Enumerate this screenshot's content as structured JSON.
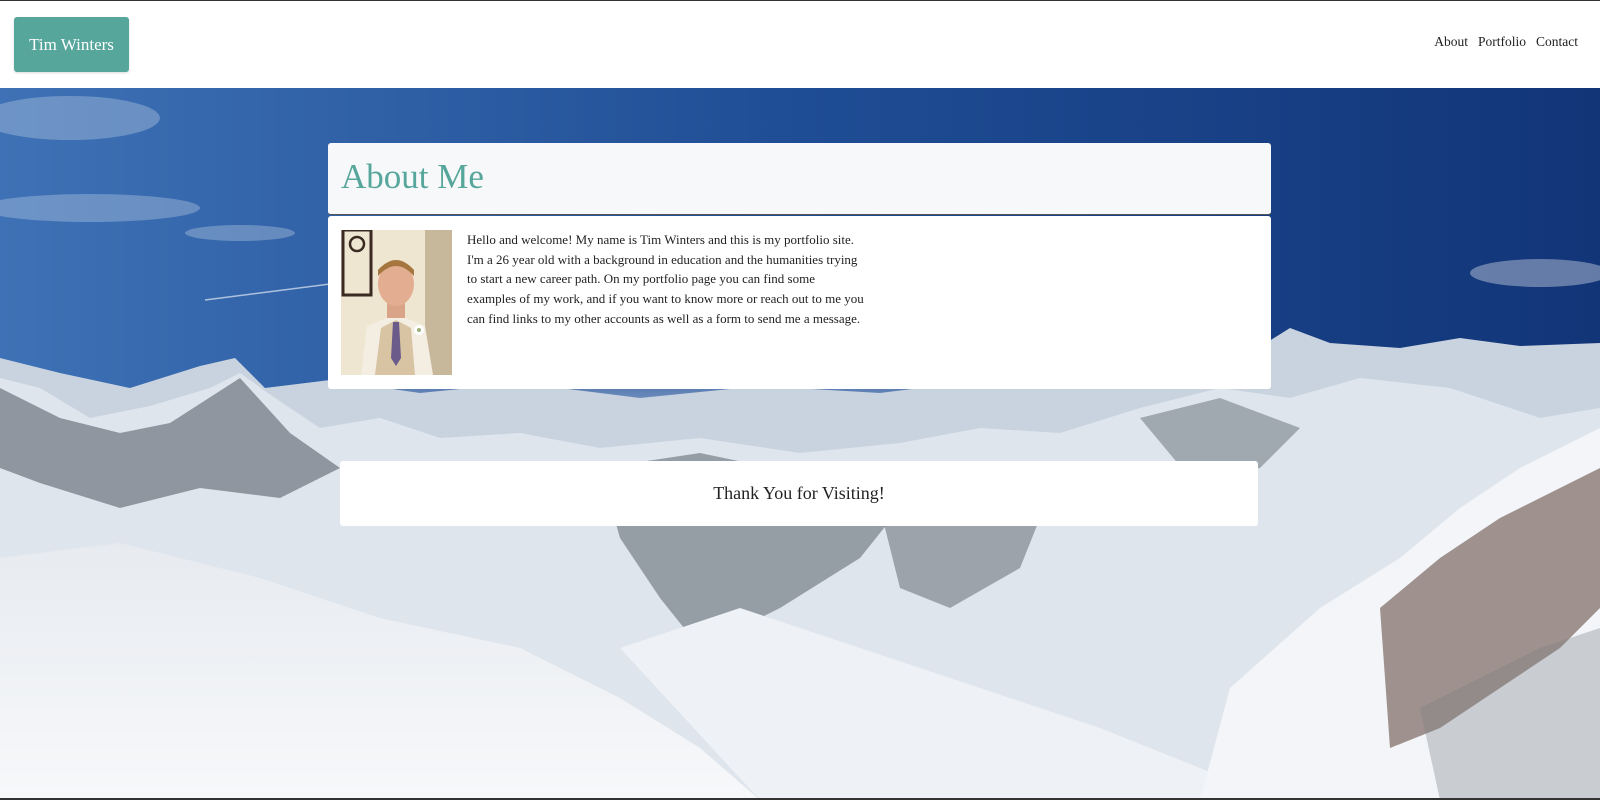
{
  "navbar": {
    "brand": "Tim Winters",
    "links": [
      "About",
      "Portfolio",
      "Contact"
    ]
  },
  "about": {
    "title": "About Me",
    "bio": "Hello and welcome! My name is Tim Winters and this is my portfolio site. I'm a 26 year old with a background in education and the humanities trying to start a new career path. On my portfolio page you can find some examples of my work, and if you want to know more or reach out to me you can find links to my other accounts as well as a form to send me a message."
  },
  "footer": {
    "message": "Thank You for Visiting!"
  },
  "colors": {
    "accent": "#57a69c",
    "panel_bg": "#f7f8f9"
  }
}
